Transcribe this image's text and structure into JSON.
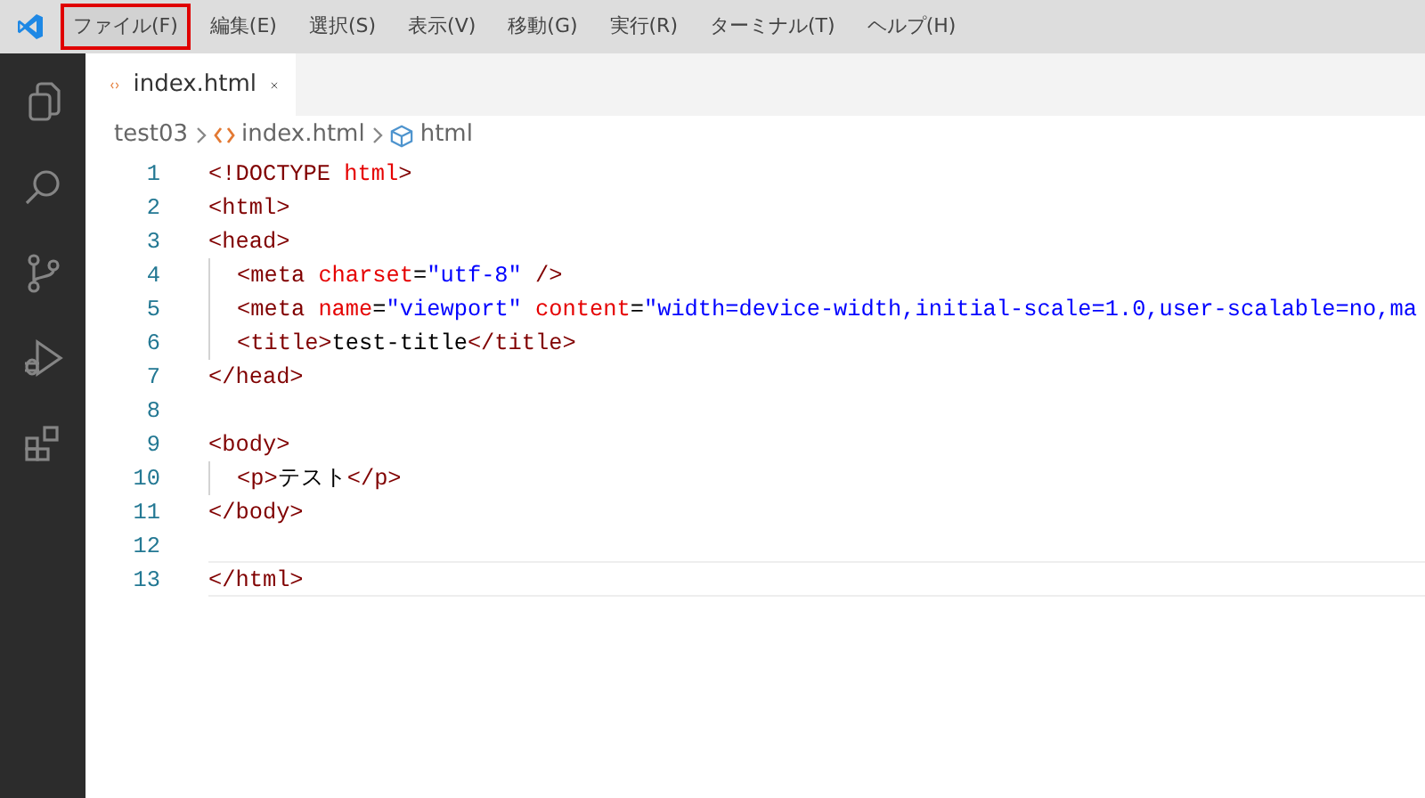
{
  "menu": [
    {
      "label": "ファイル(F)",
      "highlighted": true
    },
    {
      "label": "編集(E)",
      "highlighted": false
    },
    {
      "label": "選択(S)",
      "highlighted": false
    },
    {
      "label": "表示(V)",
      "highlighted": false
    },
    {
      "label": "移動(G)",
      "highlighted": false
    },
    {
      "label": "実行(R)",
      "highlighted": false
    },
    {
      "label": "ターミナル(T)",
      "highlighted": false
    },
    {
      "label": "ヘルプ(H)",
      "highlighted": false
    }
  ],
  "activity_bar": [
    {
      "kind": "explorer"
    },
    {
      "kind": "search"
    },
    {
      "kind": "source-control"
    },
    {
      "kind": "run"
    },
    {
      "kind": "extensions"
    }
  ],
  "tabs": [
    {
      "label": "index.html",
      "selected": true
    }
  ],
  "breadcrumbs": [
    {
      "kind": "folder",
      "label": "test03"
    },
    {
      "kind": "file",
      "label": "index.html"
    },
    {
      "kind": "element",
      "label": "html"
    }
  ],
  "editor": {
    "lines": [
      {
        "number": "1",
        "indented": false,
        "current": false,
        "tokens": [
          {
            "kind": "tag",
            "text": "<!DOCTYPE "
          },
          {
            "kind": "attr",
            "text": "html"
          },
          {
            "kind": "tag",
            "text": ">"
          }
        ]
      },
      {
        "number": "2",
        "indented": false,
        "current": false,
        "tokens": [
          {
            "kind": "tag",
            "text": "<html>"
          }
        ]
      },
      {
        "number": "3",
        "indented": false,
        "current": false,
        "tokens": [
          {
            "kind": "tag",
            "text": "<head>"
          }
        ]
      },
      {
        "number": "4",
        "indented": true,
        "current": false,
        "tokens": [
          {
            "kind": "tag",
            "text": "<meta "
          },
          {
            "kind": "attr",
            "text": "charset"
          },
          {
            "kind": "text",
            "text": "="
          },
          {
            "kind": "value",
            "text": "\"utf-8\""
          },
          {
            "kind": "tag",
            "text": " />"
          }
        ]
      },
      {
        "number": "5",
        "indented": true,
        "current": false,
        "tokens": [
          {
            "kind": "tag",
            "text": "<meta "
          },
          {
            "kind": "attr",
            "text": "name"
          },
          {
            "kind": "text",
            "text": "="
          },
          {
            "kind": "value",
            "text": "\"viewport\""
          },
          {
            "kind": "attr",
            "text": " content"
          },
          {
            "kind": "text",
            "text": "="
          },
          {
            "kind": "value",
            "text": "\"width=device-width,initial-scale=1.0,user-scalable=no,ma"
          }
        ]
      },
      {
        "number": "6",
        "indented": true,
        "current": false,
        "tokens": [
          {
            "kind": "tag",
            "text": "<title>"
          },
          {
            "kind": "text",
            "text": "test-title"
          },
          {
            "kind": "tag",
            "text": "</title>"
          }
        ]
      },
      {
        "number": "7",
        "indented": false,
        "current": false,
        "tokens": [
          {
            "kind": "tag",
            "text": "</head>"
          }
        ]
      },
      {
        "number": "8",
        "indented": false,
        "current": false
      },
      {
        "number": "9",
        "indented": false,
        "current": false,
        "tokens": [
          {
            "kind": "tag",
            "text": "<body>"
          }
        ]
      },
      {
        "number": "10",
        "indented": true,
        "current": false,
        "tokens": [
          {
            "kind": "tag",
            "text": "<p>"
          },
          {
            "kind": "text",
            "text": "テスト"
          },
          {
            "kind": "tag",
            "text": "</p>"
          }
        ]
      },
      {
        "number": "11",
        "indented": false,
        "current": false,
        "tokens": [
          {
            "kind": "tag",
            "text": "</body>"
          }
        ]
      },
      {
        "number": "12",
        "indented": false,
        "current": false
      },
      {
        "number": "13",
        "indented": false,
        "current": true,
        "tokens": [
          {
            "kind": "tag",
            "text": "</html>"
          }
        ]
      }
    ]
  }
}
